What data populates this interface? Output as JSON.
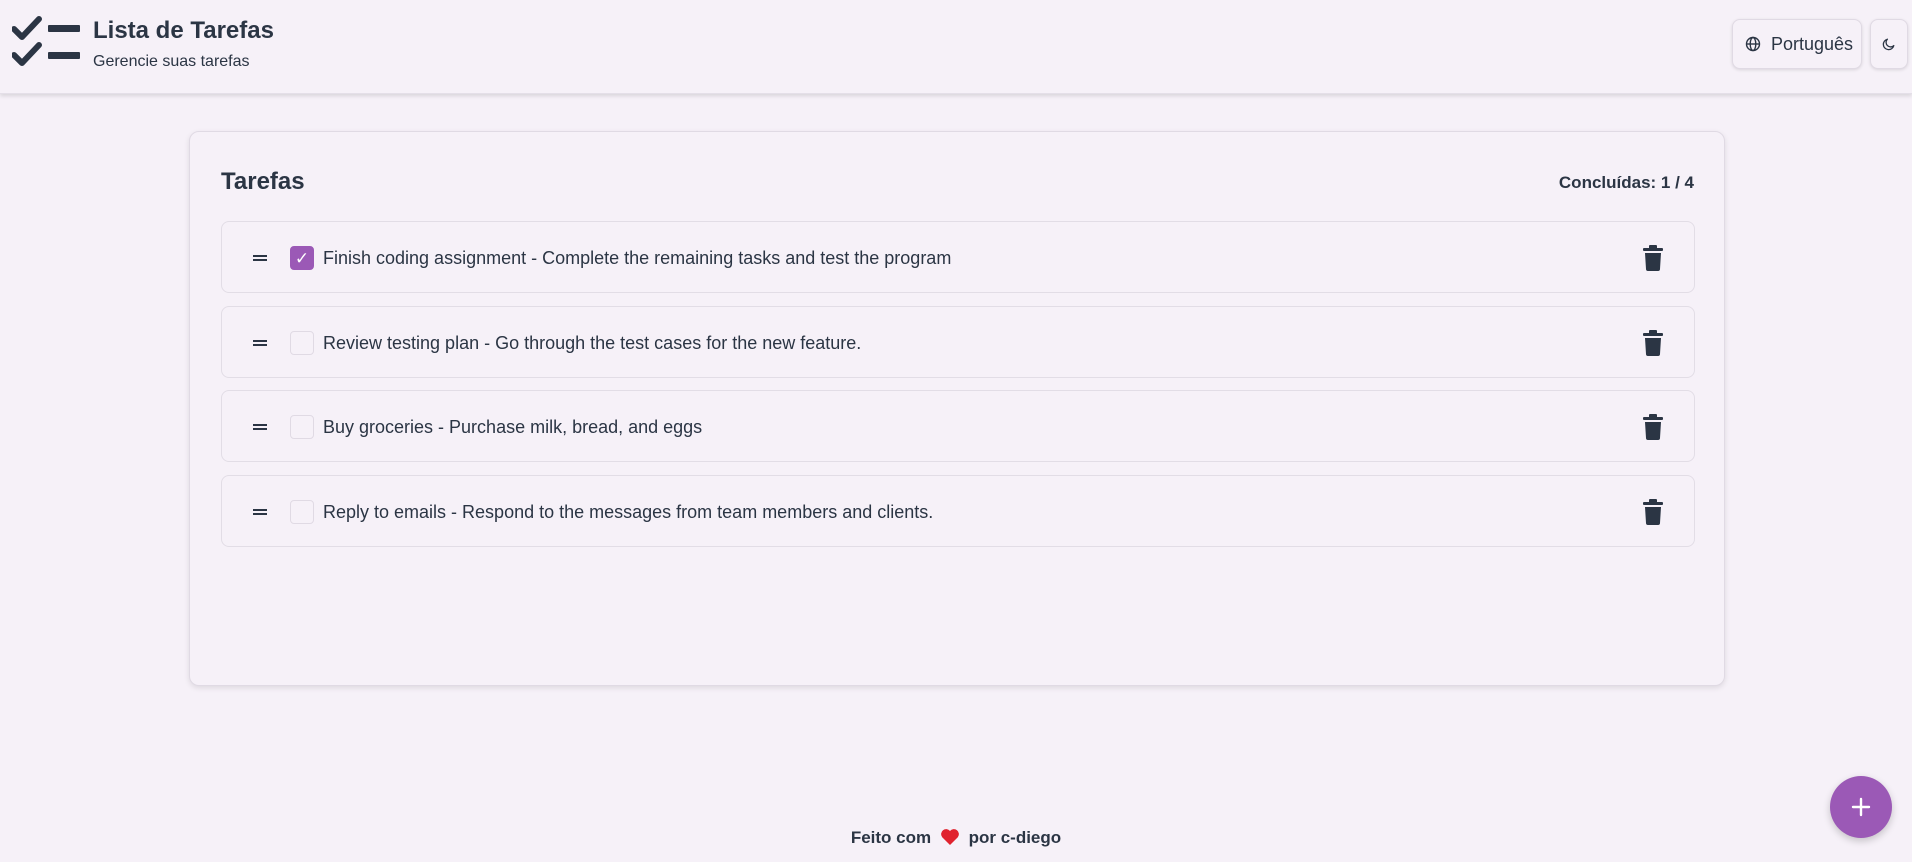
{
  "header": {
    "logo_icon": "checklist-icon",
    "title": "Lista de Tarefas",
    "subtitle": "Gerencie suas tarefas",
    "language_label": "Português",
    "language_icon": "globe-icon",
    "theme_icon": "moon-icon"
  },
  "tasks_card": {
    "title": "Tarefas",
    "completed_label": "Concluídas: 1 / 4",
    "tasks": [
      {
        "text": "Finish coding assignment - Complete the remaining tasks and test the program",
        "done": true
      },
      {
        "text": "Review testing plan - Go through the test cases for the new feature.",
        "done": false
      },
      {
        "text": "Buy groceries - Purchase milk, bread, and eggs",
        "done": false
      },
      {
        "text": "Reply to emails - Respond to the messages from team members and clients.",
        "done": false
      }
    ],
    "drag_icon": "drag-handle-icon",
    "delete_icon": "trash-icon"
  },
  "footer": {
    "prefix": "Feito com",
    "suffix": "por c-diego",
    "heart_icon": "heart-icon"
  },
  "fab": {
    "icon": "plus-icon"
  },
  "colors": {
    "accent": "#9b59b6",
    "background": "#f6f1f8",
    "text": "#2b3544",
    "heart": "#e0222e"
  }
}
